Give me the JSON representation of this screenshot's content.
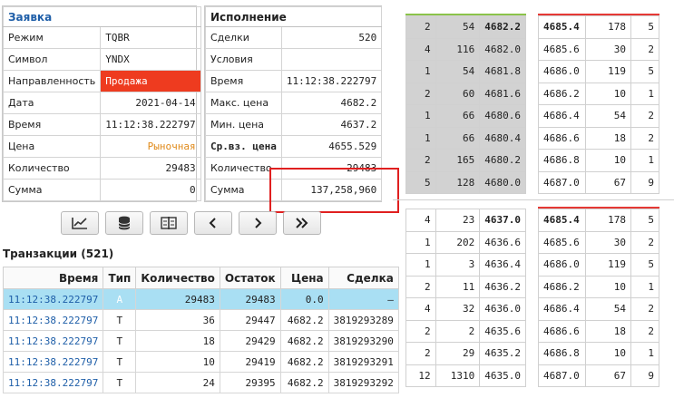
{
  "order": {
    "title": "Заявка",
    "rows": [
      {
        "label": "Режим",
        "value": "TQBR"
      },
      {
        "label": "Символ",
        "value": "YNDX"
      },
      {
        "label": "Направленность",
        "value": "Продажа"
      },
      {
        "label": "Дата",
        "value": "2021-04-14"
      },
      {
        "label": "Время",
        "value": "11:12:38.222797"
      },
      {
        "label": "Цена",
        "value": "Рыночная"
      },
      {
        "label": "Количество",
        "value": "29483"
      },
      {
        "label": "Сумма",
        "value": "0"
      }
    ]
  },
  "execution": {
    "title": "Исполнение",
    "rows": [
      {
        "label": "Сделки",
        "value": "520"
      },
      {
        "label": "Условия",
        "value": ""
      },
      {
        "label": "Время",
        "value": "11:12:38.222797"
      },
      {
        "label": "Макс. цена",
        "value": "4682.2"
      },
      {
        "label": "Мин. цена",
        "value": "4637.2"
      },
      {
        "label": "Ср.вз. цена",
        "value": "4655.529"
      },
      {
        "label": "Количество",
        "value": "29483"
      },
      {
        "label": "Сумма",
        "value": "137,258,960"
      }
    ]
  },
  "toolbar": {
    "buttons": [
      "chart-icon",
      "database-icon",
      "split-icon",
      "chevron-left-icon",
      "chevron-right-icon",
      "double-chevron-right-icon"
    ]
  },
  "transactions": {
    "title": "Транзакции (521)",
    "columns": [
      "Время",
      "Тип",
      "Количество",
      "Остаток",
      "Цена",
      "Сделка"
    ],
    "rows": [
      [
        "11:12:38.222797",
        "A",
        "29483",
        "29483",
        "0.0",
        "–"
      ],
      [
        "11:12:38.222797",
        "T",
        "36",
        "29447",
        "4682.2",
        "3819293289"
      ],
      [
        "11:12:38.222797",
        "T",
        "18",
        "29429",
        "4682.2",
        "3819293290"
      ],
      [
        "11:12:38.222797",
        "T",
        "10",
        "29419",
        "4682.2",
        "3819293291"
      ],
      [
        "11:12:38.222797",
        "T",
        "24",
        "29395",
        "4682.2",
        "3819293292"
      ]
    ]
  },
  "book_before": {
    "bids": [
      [
        "2",
        "54",
        "4682.2"
      ],
      [
        "4",
        "116",
        "4682.0"
      ],
      [
        "1",
        "54",
        "4681.8"
      ],
      [
        "2",
        "60",
        "4681.6"
      ],
      [
        "1",
        "66",
        "4680.6"
      ],
      [
        "1",
        "66",
        "4680.4"
      ],
      [
        "2",
        "165",
        "4680.2"
      ],
      [
        "5",
        "128",
        "4680.0"
      ]
    ],
    "asks": [
      [
        "4685.4",
        "178",
        "5"
      ],
      [
        "4685.6",
        "30",
        "2"
      ],
      [
        "4686.0",
        "119",
        "5"
      ],
      [
        "4686.2",
        "10",
        "1"
      ],
      [
        "4686.4",
        "54",
        "2"
      ],
      [
        "4686.6",
        "18",
        "2"
      ],
      [
        "4686.8",
        "10",
        "1"
      ],
      [
        "4687.0",
        "67",
        "9"
      ]
    ]
  },
  "book_after": {
    "bids": [
      [
        "4",
        "23",
        "4637.0"
      ],
      [
        "1",
        "202",
        "4636.6"
      ],
      [
        "1",
        "3",
        "4636.4"
      ],
      [
        "2",
        "11",
        "4636.2"
      ],
      [
        "4",
        "32",
        "4636.0"
      ],
      [
        "2",
        "2",
        "4635.6"
      ],
      [
        "2",
        "29",
        "4635.2"
      ],
      [
        "12",
        "1310",
        "4635.0"
      ]
    ],
    "asks": [
      [
        "4685.4",
        "178",
        "5"
      ],
      [
        "4685.6",
        "30",
        "2"
      ],
      [
        "4686.0",
        "119",
        "5"
      ],
      [
        "4686.2",
        "10",
        "1"
      ],
      [
        "4686.4",
        "54",
        "2"
      ],
      [
        "4686.6",
        "18",
        "2"
      ],
      [
        "4686.8",
        "10",
        "1"
      ],
      [
        "4687.0",
        "67",
        "9"
      ]
    ]
  }
}
